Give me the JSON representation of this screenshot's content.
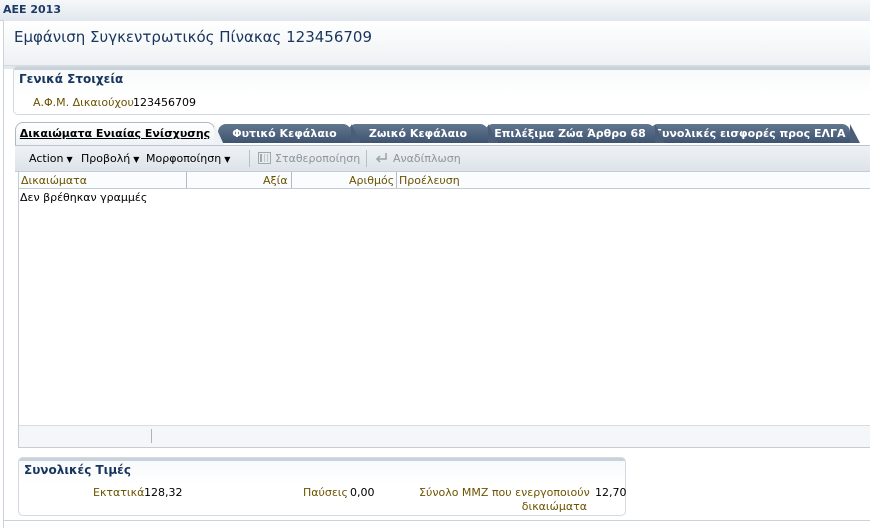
{
  "app": {
    "title": "ΑΕΕ 2013"
  },
  "page": {
    "title": "Εμφάνιση Συγκεντρωτικός Πίνακας 123456709"
  },
  "general": {
    "title": "Γενικά Στοιχεία",
    "afm_label": "Α.Φ.Μ. Δικαιούχου",
    "afm_value": "123456709"
  },
  "tabs": [
    {
      "label": "Δικαιώματα Ενιαίας Ενίσχυσης",
      "active": true
    },
    {
      "label": "Φυτικό Κεφάλαιο",
      "active": false
    },
    {
      "label": "Ζωικό Κεφάλαιο",
      "active": false
    },
    {
      "label": "Επιλέξιμα Ζώα Άρθρο 68",
      "active": false
    },
    {
      "label": "Συνολικές εισφορές προς ΕΛΓΑ",
      "active": false
    }
  ],
  "toolbar": {
    "action": "Action",
    "view": "Προβολή",
    "format": "Μορφοποίηση",
    "freeze": "Σταθεροποίηση",
    "wrap": "Αναδίπλωση",
    "freeze_icon": "freeze-columns-icon",
    "wrap_icon": "wrap-arrow-icon"
  },
  "table": {
    "columns": [
      "Δικαιώματα",
      "Αξία",
      "Αριθμός",
      "Προέλευση"
    ],
    "empty_message": "Δεν βρέθηκαν γραμμές"
  },
  "totals": {
    "title": "Συνολικές Τιμές",
    "ektatika_label": "Εκτατικά",
    "ektatika_value": "128,32",
    "pauseis_label": "Παύσεις",
    "pauseis_value": "0,00",
    "mmz_label_line1": "Σύνολο ΜΜΖ που ενεργοποιούν",
    "mmz_label_line2": "δικαιώματα",
    "mmz_value": "12,70"
  },
  "colors": {
    "title_blue": "#18355e",
    "label_gold": "#6b5300",
    "tab_dark": "#4a5e7a"
  }
}
